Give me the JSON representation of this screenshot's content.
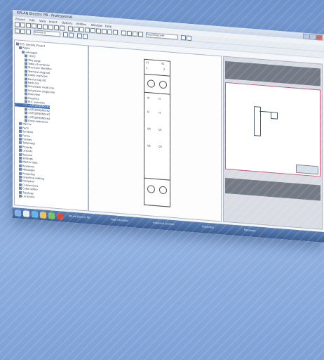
{
  "window": {
    "title": "EPLAN Electric P8 - Professional",
    "menu": [
      "Project",
      "Edit",
      "View",
      "Insert",
      "Options",
      "Utilities",
      "Window",
      "Help"
    ]
  },
  "toolbar": {
    "combo1": "Potentialpunkt",
    "combo2": "Standard"
  },
  "tree": {
    "items": [
      {
        "label": "ESS_Sample_Project",
        "indent": 0
      },
      {
        "label": "Pages",
        "indent": 1
      },
      {
        "label": "=Anlage1",
        "indent": 2
      },
      {
        "label": "+Ort1",
        "indent": 3
      },
      {
        "label": "Title page",
        "indent": 3
      },
      {
        "label": "Table of contents",
        "indent": 3
      },
      {
        "label": "Structure identifier",
        "indent": 3
      },
      {
        "label": "Terminal diagram",
        "indent": 3
      },
      {
        "label": "Cable overview",
        "indent": 3
      },
      {
        "label": "Device tag list",
        "indent": 3
      },
      {
        "label": "Parts list",
        "indent": 3
      },
      {
        "label": "Schematic multi-line",
        "indent": 3
      },
      {
        "label": "Schematic single-line",
        "indent": 3
      },
      {
        "label": "Overview",
        "indent": 3
      },
      {
        "label": "Graphics",
        "indent": 3
      },
      {
        "label": "PLC overview",
        "indent": 3
      },
      {
        "label": "=STEUERUNG-K1",
        "indent": 3,
        "sel": true
      },
      {
        "label": "=STEUERUNG-K2",
        "indent": 3
      },
      {
        "label": "=STEUERUNG-K3",
        "indent": 3
      },
      {
        "label": "=STEUERUNG-K4",
        "indent": 3
      },
      {
        "label": "Cross-reference",
        "indent": 3
      },
      {
        "label": "Macros",
        "indent": 1
      },
      {
        "label": "Parts",
        "indent": 1
      },
      {
        "label": "Symbols",
        "indent": 1
      },
      {
        "label": "Forms",
        "indent": 1
      },
      {
        "label": "Frames",
        "indent": 1
      },
      {
        "label": "Templates",
        "indent": 1
      },
      {
        "label": "Projects",
        "indent": 1
      },
      {
        "label": "Layouts",
        "indent": 1
      },
      {
        "label": "Reports",
        "indent": 1
      },
      {
        "label": "Settings",
        "indent": 1
      },
      {
        "label": "Master data",
        "indent": 1
      },
      {
        "label": "Revisions",
        "indent": 1
      },
      {
        "label": "Messages",
        "indent": 1
      },
      {
        "label": "Properties",
        "indent": 1
      },
      {
        "label": "Graphical editing",
        "indent": 1
      },
      {
        "label": "Navigator",
        "indent": 1
      },
      {
        "label": "Connections",
        "indent": 1
      },
      {
        "label": "Cable editor",
        "indent": 1
      },
      {
        "label": "Topology",
        "indent": 1
      },
      {
        "label": "Locations",
        "indent": 1
      }
    ]
  },
  "taskbar": {
    "items": [
      "EPLAN Electric P8",
      "Page navigator",
      "Graphical preview",
      "Properties",
      "Messages"
    ]
  }
}
